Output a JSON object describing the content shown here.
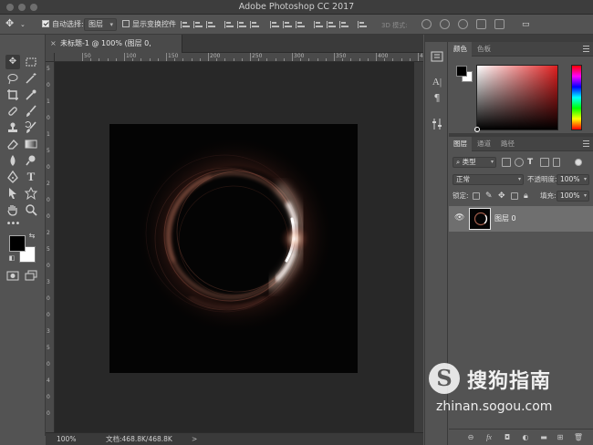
{
  "app": {
    "title": "Adobe Photoshop CC 2017"
  },
  "options_bar": {
    "auto_select_label": "自动选择:",
    "auto_select_checked": true,
    "auto_select_target": "图层",
    "show_transform_label": "显示变换控件",
    "show_transform_checked": false,
    "mode_3d_label": "3D 模式:"
  },
  "document": {
    "tab_label": "未标题-1 @ 100% (图层 0, RGB/8*) *",
    "close_glyph": "×",
    "ruler_ticks": [
      "50",
      "100",
      "150",
      "200",
      "250",
      "300",
      "350",
      "400",
      "450"
    ],
    "ruler_ticks_v": [
      "5",
      "0",
      "1",
      "0",
      "1",
      "5",
      "0",
      "2",
      "0",
      "0",
      "2",
      "5",
      "0",
      "3",
      "0",
      "0",
      "3",
      "5",
      "0",
      "4",
      "0",
      "0"
    ]
  },
  "status_bar": {
    "zoom": "100%",
    "doc_info": "文档:468.8K/468.8K",
    "arrow": ">"
  },
  "panels": {
    "color_tabs": [
      "颜色",
      "色板"
    ],
    "layers_tabs": [
      "图层",
      "通道",
      "路径"
    ],
    "filter_type": "类型",
    "blend_mode": "正常",
    "opacity_label": "不透明度:",
    "opacity_value": "100%",
    "lock_label": "锁定:",
    "fill_label": "填充:",
    "fill_value": "100%",
    "layer_name": "图层 0",
    "layer_visible": true
  },
  "colors": {
    "foreground": "#000000",
    "background": "#ffffff",
    "panel_bg": "#535353",
    "pasteboard": "#282828"
  },
  "watermark": {
    "logo_letter": "S",
    "brand": "搜狗指南",
    "url": "zhinan.sogou.com"
  }
}
